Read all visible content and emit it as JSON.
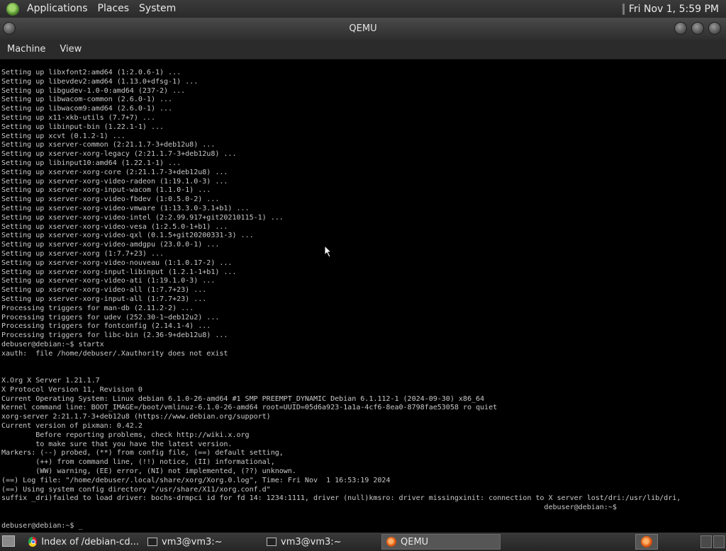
{
  "top_panel": {
    "menus": [
      "Applications",
      "Places",
      "System"
    ],
    "clock": "Fri Nov  1,  5:59 PM"
  },
  "window": {
    "title": "QEMU",
    "menubar": [
      "Machine",
      "View"
    ]
  },
  "console_text": "Setting up libxfont2:amd64 (1:2.0.6-1) ...\nSetting up libevdev2:amd64 (1.13.0+dfsg-1) ...\nSetting up libgudev-1.0-0:amd64 (237-2) ...\nSetting up libwacom-common (2.6.0-1) ...\nSetting up libwacom9:amd64 (2.6.0-1) ...\nSetting up x11-xkb-utils (7.7+7) ...\nSetting up libinput-bin (1.22.1-1) ...\nSetting up xcvt (0.1.2-1) ...\nSetting up xserver-common (2:21.1.7-3+deb12u8) ...\nSetting up xserver-xorg-legacy (2:21.1.7-3+deb12u8) ...\nSetting up libinput10:amd64 (1.22.1-1) ...\nSetting up xserver-xorg-core (2:21.1.7-3+deb12u8) ...\nSetting up xserver-xorg-video-radeon (1:19.1.0-3) ...\nSetting up xserver-xorg-input-wacom (1.1.0-1) ...\nSetting up xserver-xorg-video-fbdev (1:0.5.0-2) ...\nSetting up xserver-xorg-video-vmware (1:13.3.0-3.1+b1) ...\nSetting up xserver-xorg-video-intel (2:2.99.917+git20210115-1) ...\nSetting up xserver-xorg-video-vesa (1:2.5.0-1+b1) ...\nSetting up xserver-xorg-video-qxl (0.1.5+git20200331-3) ...\nSetting up xserver-xorg-video-amdgpu (23.0.0-1) ...\nSetting up xserver-xorg (1:7.7+23) ...\nSetting up xserver-xorg-video-nouveau (1:1.0.17-2) ...\nSetting up xserver-xorg-input-libinput (1.2.1-1+b1) ...\nSetting up xserver-xorg-video-ati (1:19.1.0-3) ...\nSetting up xserver-xorg-video-all (1:7.7+23) ...\nSetting up xserver-xorg-input-all (1:7.7+23) ...\nProcessing triggers for man-db (2.11.2-2) ...\nProcessing triggers for udev (252.30-1~deb12u2) ...\nProcessing triggers for fontconfig (2.14.1-4) ...\nProcessing triggers for libc-bin (2.36-9+deb12u8) ...\ndebuser@debian:~$ startx\nxauth:  file /home/debuser/.Xauthority does not exist\n\n\nX.Org X Server 1.21.1.7\nX Protocol Version 11, Revision 0\nCurrent Operating System: Linux debian 6.1.0-26-amd64 #1 SMP PREEMPT_DYNAMIC Debian 6.1.112-1 (2024-09-30) x86_64\nKernel command line: BOOT_IMAGE=/boot/vmlinuz-6.1.0-26-amd64 root=UUID=05d6a923-1a1a-4cf6-8ea0-8798fae53058 ro quiet\nxorg-server 2:21.1.7-3+deb12u8 (https://www.debian.org/support)\nCurrent version of pixman: 0.42.2\n        Before reporting problems, check http://wiki.x.org\n        to make sure that you have the latest version.\nMarkers: (--) probed, (**) from config file, (==) default setting,\n        (++) from command line, (!!) notice, (II) informational,\n        (WW) warning, (EE) error, (NI) not implemented, (??) unknown.\n(==) Log file: \"/home/debuser/.local/share/xorg/Xorg.0.log\", Time: Fri Nov  1 16:53:19 2024\n(==) Using system config directory \"/usr/share/X11/xorg.conf.d\"\nsuffix _dri)failed to load driver: bochs-drmpci id for fd 14: 1234:1111, driver (null)kmsro: driver missingxinit: connection to X server lost/dri:/usr/lib/dri,\n                                                                                                                               debuser@debian:~$\n\ndebuser@debian:~$ _",
  "taskbar": {
    "tasks": [
      {
        "label": "Index of /debian-cd...",
        "icon": "chrome-icon"
      },
      {
        "label": "vm3@vm3:~",
        "icon": "terminal-icon"
      },
      {
        "label": "vm3@vm3:~",
        "icon": "terminal-icon"
      },
      {
        "label": "QEMU",
        "icon": "qemu-icon",
        "active": true
      }
    ]
  }
}
